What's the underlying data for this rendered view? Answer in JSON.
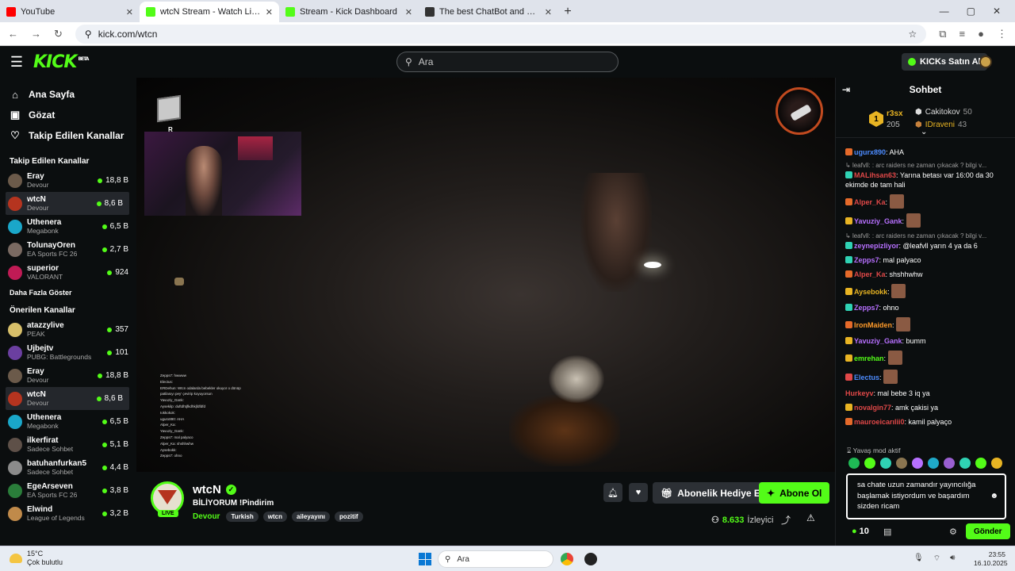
{
  "browser": {
    "tabs": [
      {
        "title": "YouTube",
        "color": "#ff0000",
        "active": false
      },
      {
        "title": "wtcN Stream - Watch Live o",
        "color": "#53fc18",
        "active": true
      },
      {
        "title": "Stream - Kick Dashboard",
        "color": "#53fc18",
        "active": false
      },
      {
        "title": "The best ChatBot and Widgets",
        "color": "#333333",
        "active": false
      }
    ],
    "url": "kick.com/wtcn"
  },
  "header": {
    "logo": "KICK",
    "logo_tag": "BETA",
    "search_placeholder": "Ara",
    "kicks_button": "KICKs Satın Al"
  },
  "sidebar": {
    "nav": [
      {
        "label": "Ana Sayfa",
        "icon": "home-icon",
        "glyph": "⌂"
      },
      {
        "label": "Gözat",
        "icon": "browse-icon",
        "glyph": "▣"
      },
      {
        "label": "Takip Edilen Kanallar",
        "icon": "heart-icon",
        "glyph": "♡"
      }
    ],
    "followed_title": "Takip Edilen Kanallar",
    "followed": [
      {
        "name": "Eray",
        "category": "Devour",
        "viewers": "18,8 B",
        "color": "#6b5a4a"
      },
      {
        "name": "wtcN",
        "category": "Devour",
        "viewers": "8,6 B",
        "color": "#b5341f",
        "selected": true
      },
      {
        "name": "Uthenera",
        "category": "Megabonk",
        "viewers": "6,5 B",
        "color": "#1aa7c9"
      },
      {
        "name": "TolunayOren",
        "category": "EA Sports FC 26",
        "viewers": "2,7 B",
        "color": "#7a6a62"
      },
      {
        "name": "superior",
        "category": "VALORANT",
        "viewers": "924",
        "color": "#c01b55"
      }
    ],
    "show_more": "Daha Fazla Göster",
    "recommended_title": "Önerilen Kanallar",
    "recommended": [
      {
        "name": "atazzylive",
        "category": "PEAK",
        "viewers": "357",
        "color": "#d8c06a"
      },
      {
        "name": "Ujbejtv",
        "category": "PUBG: Battlegrounds",
        "viewers": "101",
        "color": "#6b3fa0"
      },
      {
        "name": "Eray",
        "category": "Devour",
        "viewers": "18,8 B",
        "color": "#6b5a4a"
      },
      {
        "name": "wtcN",
        "category": "Devour",
        "viewers": "8,6 B",
        "color": "#b5341f",
        "selected": true
      },
      {
        "name": "Uthenera",
        "category": "Megabonk",
        "viewers": "6,5 B",
        "color": "#1aa7c9"
      },
      {
        "name": "ilkerfirat",
        "category": "Sadece Sohbet",
        "viewers": "5,1 B",
        "color": "#5e5048"
      },
      {
        "name": "batuhanfurkan5",
        "category": "Sadece Sohbet",
        "viewers": "4,4 B",
        "color": "#8b8b8b"
      },
      {
        "name": "EgeArseven",
        "category": "EA Sports FC 26",
        "viewers": "3,8 B",
        "color": "#2a7d3a"
      },
      {
        "name": "Elwind",
        "category": "League of Legends",
        "viewers": "3,2 B",
        "color": "#c08a4a"
      }
    ]
  },
  "video": {
    "hud_label": "R",
    "overlay_chat": [
      "Zepps7: hwwww",
      "Electus:",
      "ERDehun: Wtcn odalarda bebekler okuyor o dönüp",
      "patilasıyı pey' çevirip koyuyorsun",
      "Yavuziy_Gank:",
      "Aysekilp: duftdhtjfkdhkjfdfdfd",
      "Iokkokok:",
      "ugurx890: AHA",
      "Alper_Ka:",
      "Yavuziy_Gank:",
      "Zepps7: mal palyaco",
      "Alper_Ka: shshhwhw",
      "Aysebokk:",
      "Zepps7: ohno"
    ]
  },
  "stream": {
    "name": "wtcN",
    "live": "LIVE",
    "title": "BİLİYORUM !Pindirim",
    "category": "Devour",
    "tags": [
      "Turkish",
      "wtcn",
      "aileyayını",
      "pozitif"
    ],
    "gift_button": "Abonelik Hediye Et",
    "subscribe_button": "Abone Ol",
    "viewers": "8.633",
    "viewers_label": "İzleyici"
  },
  "chat": {
    "title": "Sohbet",
    "leaderboard": {
      "first": {
        "name": "r3sx",
        "value": "205"
      },
      "second": {
        "name": "Cakitokov",
        "value": "50"
      },
      "third": {
        "name": "IDraveni",
        "value": "43"
      }
    },
    "messages": [
      {
        "user": "ugurx890",
        "color": "#4d8cff",
        "text": ": AHA",
        "badge": "#e56a2a"
      },
      {
        "reply": "leafvll: : arc raiders ne zaman çıkacak ? bilgi v..."
      },
      {
        "user": "MALihsan63",
        "color": "#e04848",
        "text": ": Yarına betası var 16:00 da 30 ekimde de tam hali",
        "badge": "#2fd2b4"
      },
      {
        "user": "Alper_Ka",
        "color": "#e04848",
        "text": ":",
        "badge": "#e56a2a",
        "emote": true
      },
      {
        "user": "Yavuziy_Gank",
        "color": "#b770ff",
        "text": ":",
        "badge": "#e8b423",
        "emote": true
      },
      {
        "reply": "leafvll: : arc raiders ne zaman çıkacak ? bilgi v..."
      },
      {
        "user": "zeynepizliyor",
        "color": "#b770ff",
        "text": ": @leafvll yarın 4 ya da 6",
        "badge": "#2fd2b4"
      },
      {
        "user": "Zepps7",
        "color": "#b770ff",
        "text": ": mal palyaco",
        "badge": "#2fd2b4"
      },
      {
        "user": "Alper_Ka",
        "color": "#e04848",
        "text": ": shshhwhw",
        "badge": "#e56a2a"
      },
      {
        "user": "Aysebokk",
        "color": "#e8b423",
        "text": ":",
        "badge": "#e8b423",
        "emote": true
      },
      {
        "user": "Zepps7",
        "color": "#b770ff",
        "text": ": ohno",
        "badge": "#2fd2b4"
      },
      {
        "user": "IronMaiden",
        "color": "#ff9b2a",
        "text": ":",
        "badge": "#e56a2a",
        "emote": true
      },
      {
        "user": "Yavuziy_Gank",
        "color": "#b770ff",
        "text": ": bumm",
        "badge": "#e8b423"
      },
      {
        "user": "emrehan",
        "color": "#53fc18",
        "text": ":",
        "badge": "#e8b423",
        "emote": true
      },
      {
        "user": "Electus",
        "color": "#4d8cff",
        "text": ":",
        "badge": "#e04848",
        "emote": true
      },
      {
        "user": "Hurkeyv",
        "color": "#e04848",
        "text": ": mal bebe 3 iq ya"
      },
      {
        "user": "novalgin77",
        "color": "#e04848",
        "text": ": amk çakisi ya",
        "badge": "#e8b423"
      },
      {
        "user": "mauroeicarılii0",
        "color": "#e04848",
        "text": ": kamil palyaço",
        "badge": "#e56a2a"
      }
    ],
    "slow_mode": "Yavaş mod aktif",
    "input_text": "sa chate uzun zamandır yayıncılığa başlamak istiyordum ve başardım sizden ricam",
    "points": "10",
    "send_button": "Gönder"
  },
  "taskbar": {
    "temp": "15°C",
    "weather": "Çok bulutlu",
    "search": "Ara",
    "time": "23:55",
    "date": "16.10.2025"
  }
}
